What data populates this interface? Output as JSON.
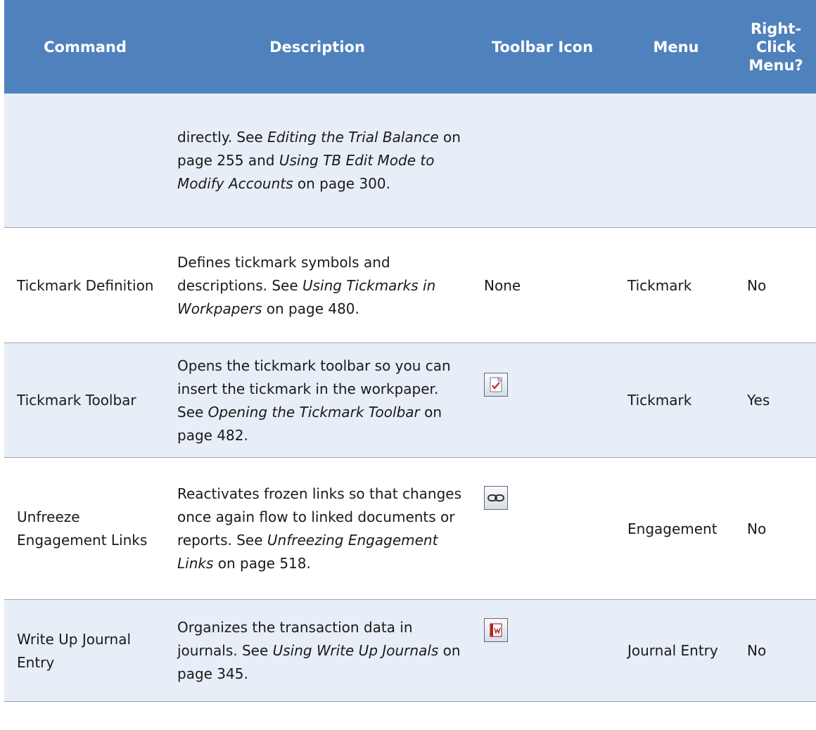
{
  "header": {
    "command": "Command",
    "description": "Description",
    "toolbar_icon": "Toolbar Icon",
    "menu": "Menu",
    "right_click_1": "Right-",
    "right_click_2": "Click",
    "right_click_3": "Menu?"
  },
  "rows": [
    {
      "command": "",
      "description": [
        {
          "text": "directly. See ",
          "italic": false
        },
        {
          "text": "Editing the Trial Balance",
          "italic": true
        },
        {
          "text": " on page 255 and ",
          "italic": false
        },
        {
          "text": "Using TB Edit Mode to Modify Accounts",
          "italic": true
        },
        {
          "text": " on page 300.",
          "italic": false
        }
      ],
      "icon": "",
      "menu": "",
      "right_click": ""
    },
    {
      "command": "Tickmark Definition",
      "description": [
        {
          "text": "Defines tickmark symbols and descriptions. See ",
          "italic": false
        },
        {
          "text": "Using Tickmarks in Workpapers",
          "italic": true
        },
        {
          "text": " on page 480.",
          "italic": false
        }
      ],
      "icon_text": "None",
      "menu": "Tickmark",
      "right_click": "No"
    },
    {
      "command": "Tickmark Toolbar",
      "description": [
        {
          "text": "Opens the tickmark toolbar so you can insert the tickmark in the workpaper. See ",
          "italic": false
        },
        {
          "text": "Opening the Tickmark Toolbar",
          "italic": true
        },
        {
          "text": " on page 482.",
          "italic": false
        }
      ],
      "icon": "tickmark-toolbar-icon",
      "menu": "Tickmark",
      "right_click": "Yes"
    },
    {
      "command": "Unfreeze Engagement Links",
      "description": [
        {
          "text": "Reactivates frozen links so that changes once again flow to linked documents or reports. See ",
          "italic": false
        },
        {
          "text": "Unfreezing Engagement Links",
          "italic": true
        },
        {
          "text": " on page 518.",
          "italic": false
        }
      ],
      "icon": "chain-link-icon",
      "menu": "Engagement",
      "right_click": "No"
    },
    {
      "command": "Write Up Journal Entry",
      "description": [
        {
          "text": "Organizes the transaction data in journals. See ",
          "italic": false
        },
        {
          "text": "Using Write Up Journals",
          "italic": true
        },
        {
          "text": " on page 345.",
          "italic": false
        }
      ],
      "icon": "write-up-journal-icon",
      "menu": "Journal Entry",
      "right_click": "No"
    }
  ],
  "colors": {
    "header_bg": "#4f81bd",
    "shaded_row_bg": "#e7eef7",
    "divider": "#9aa4b0"
  }
}
